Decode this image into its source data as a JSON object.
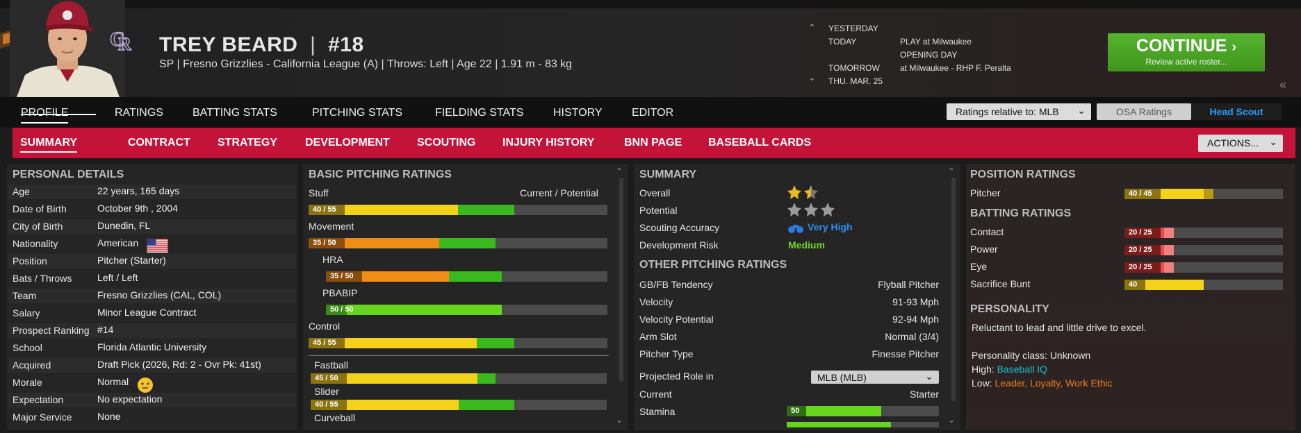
{
  "colors": {
    "accent_red": "#c41339",
    "continue_green": "#48a425",
    "yellow": "#f4d21a",
    "orange": "#f08d15",
    "green": "#39b91e",
    "lime": "#66d61c",
    "red": "#e84c4c"
  },
  "header": {
    "player_name": "TREY BEARD",
    "separator": "|",
    "number": "#18",
    "info": "SP | Fresno Grizzlies - California League (A)  |  Throws: Left  |  Age 22  |  1.91 m - 83 kg"
  },
  "schedule": {
    "yesterday": "YESTERDAY",
    "today": "TODAY",
    "today_event": "PLAY at Milwaukee",
    "today_event2": "OPENING DAY",
    "tomorrow": "TOMORROW",
    "tomorrow_event": "at Milwaukee - RHP F. Peralta",
    "next_day": "THU. MAR. 25"
  },
  "continue": {
    "label": "CONTINUE",
    "sub": "Review active roster..."
  },
  "main_tabs": [
    "PROFILE",
    "RATINGS",
    "BATTING STATS",
    "PITCHING STATS",
    "FIELDING STATS",
    "HISTORY",
    "EDITOR"
  ],
  "ratings_relative": "Ratings relative to: MLB",
  "osa_ratings": "OSA Ratings",
  "head_scout": "Head Scout",
  "sub_tabs": [
    "SUMMARY",
    "CONTRACT",
    "STRATEGY",
    "DEVELOPMENT",
    "SCOUTING",
    "INJURY HISTORY",
    "BNN PAGE",
    "BASEBALL CARDS"
  ],
  "actions": "ACTIONS...",
  "personal": {
    "title": "PERSONAL DETAILS",
    "rows": [
      {
        "label": "Age",
        "value": "22 years, 165 days"
      },
      {
        "label": "Date of Birth",
        "value": "October 9th , 2004"
      },
      {
        "label": "City of Birth",
        "value": "Dunedin, FL"
      },
      {
        "label": "Nationality",
        "value": "American"
      },
      {
        "label": "Position",
        "value": "Pitcher (Starter)"
      },
      {
        "label": "Bats / Throws",
        "value": "Left / Left"
      },
      {
        "label": "Team",
        "value": "Fresno Grizzlies (CAL, COL)"
      },
      {
        "label": "Salary",
        "value": "Minor League Contract"
      },
      {
        "label": "Prospect Ranking",
        "value": "#14"
      },
      {
        "label": "School",
        "value": "Florida Atlantic University"
      },
      {
        "label": "Acquired",
        "value": "Draft Pick (2026, Rd: 2 - Ovr Pk: 41st)"
      },
      {
        "label": "Morale",
        "value": "Normal"
      },
      {
        "label": "Expectation",
        "value": "No expectation"
      },
      {
        "label": "Major Service",
        "value": "None"
      }
    ]
  },
  "pitching": {
    "title": "BASIC PITCHING RATINGS",
    "current_potential": "Current / Potential",
    "stuff": {
      "label": "Stuff",
      "text": "40 / 55",
      "current": 40,
      "potential": 55
    },
    "movement": {
      "label": "Movement",
      "text": "35 / 50",
      "current": 35,
      "potential": 50
    },
    "hra": {
      "label": "HRA",
      "text": "35 / 50",
      "current": 35,
      "potential": 50
    },
    "pbabip": {
      "label": "PBABIP",
      "text": "50 / 50",
      "current": 50,
      "potential": 50
    },
    "control": {
      "label": "Control",
      "text": "45 / 55",
      "current": 45,
      "potential": 55
    },
    "fastball": {
      "label": "Fastball",
      "text": "45 / 50",
      "current": 45,
      "potential": 50
    },
    "slider": {
      "label": "Slider",
      "text": "40 / 55",
      "current": 40,
      "potential": 55
    },
    "curveball": {
      "label": "Curveball"
    }
  },
  "summary": {
    "title": "SUMMARY",
    "overall": "Overall",
    "overall_stars": 1.5,
    "potential": "Potential",
    "potential_stars": 0,
    "scouting_accuracy": "Scouting Accuracy",
    "scouting_value": "Very High",
    "dev_risk": "Development Risk",
    "dev_value": "Medium"
  },
  "other": {
    "title": "OTHER PITCHING RATINGS",
    "rows": [
      {
        "label": "GB/FB Tendency",
        "value": "Flyball Pitcher"
      },
      {
        "label": "Velocity",
        "value": "91-93 Mph"
      },
      {
        "label": "Velocity Potential",
        "value": "92-94 Mph"
      },
      {
        "label": "Arm Slot",
        "value": "Normal (3/4)"
      },
      {
        "label": "Pitcher Type",
        "value": "Finesse Pitcher"
      }
    ],
    "projected_role": "Projected Role in",
    "projected_select": "MLB (MLB)",
    "current": "Current",
    "current_value": "Starter",
    "stamina": "Stamina",
    "stamina_value": "50"
  },
  "position": {
    "title": "POSITION RATINGS",
    "pitcher": "Pitcher",
    "pitcher_text": "40 / 45",
    "pitcher_current": 40,
    "pitcher_potential": 45
  },
  "batting": {
    "title": "BATTING RATINGS",
    "rows": [
      {
        "label": "Contact",
        "text": "20 / 25",
        "current": 20,
        "potential": 25
      },
      {
        "label": "Power",
        "text": "20 / 25",
        "current": 20,
        "potential": 25
      },
      {
        "label": "Eye",
        "text": "20 / 25",
        "current": 20,
        "potential": 25
      },
      {
        "label": "Sacrifice Bunt",
        "text": "40",
        "current": 40,
        "potential": 40
      }
    ]
  },
  "personality": {
    "title": "PERSONALITY",
    "description": "Reluctant to lead and little drive to excel.",
    "class": "Personality class: Unknown",
    "high_label": "High:",
    "high_value": "Baseball IQ",
    "low_label": "Low:",
    "low_value": "Leader, Loyalty, Work Ethic"
  }
}
